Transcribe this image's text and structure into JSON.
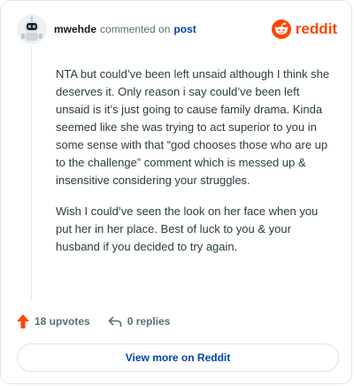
{
  "header": {
    "username": "mwehde",
    "action_text": "commented on",
    "post_link": "post",
    "brand": "reddit",
    "avatar_icon": "robot-avatar-icon",
    "brand_icon": "reddit-logo-icon",
    "brand_color": "#ff4500"
  },
  "comment": {
    "paragraphs": [
      "NTA but could’ve been left unsaid although I think she deserves it. Only reason i say could’ve been left unsaid is it’s just going to cause family drama. Kinda seemed like she was trying to act superior to you in some sense with that “god chooses those who are up to the challenge” comment which is messed up & insensitive considering your struggles.",
      "Wish I could’ve seen the look on her face when you put her in her place. Best of luck to you & your husband if you decided to try again."
    ]
  },
  "actions": {
    "upvotes": "18 upvotes",
    "replies": "0 replies",
    "upvote_icon": "upvote-arrow-icon",
    "reply_icon": "reply-arrow-icon"
  },
  "footer": {
    "view_more": "View more on Reddit"
  }
}
